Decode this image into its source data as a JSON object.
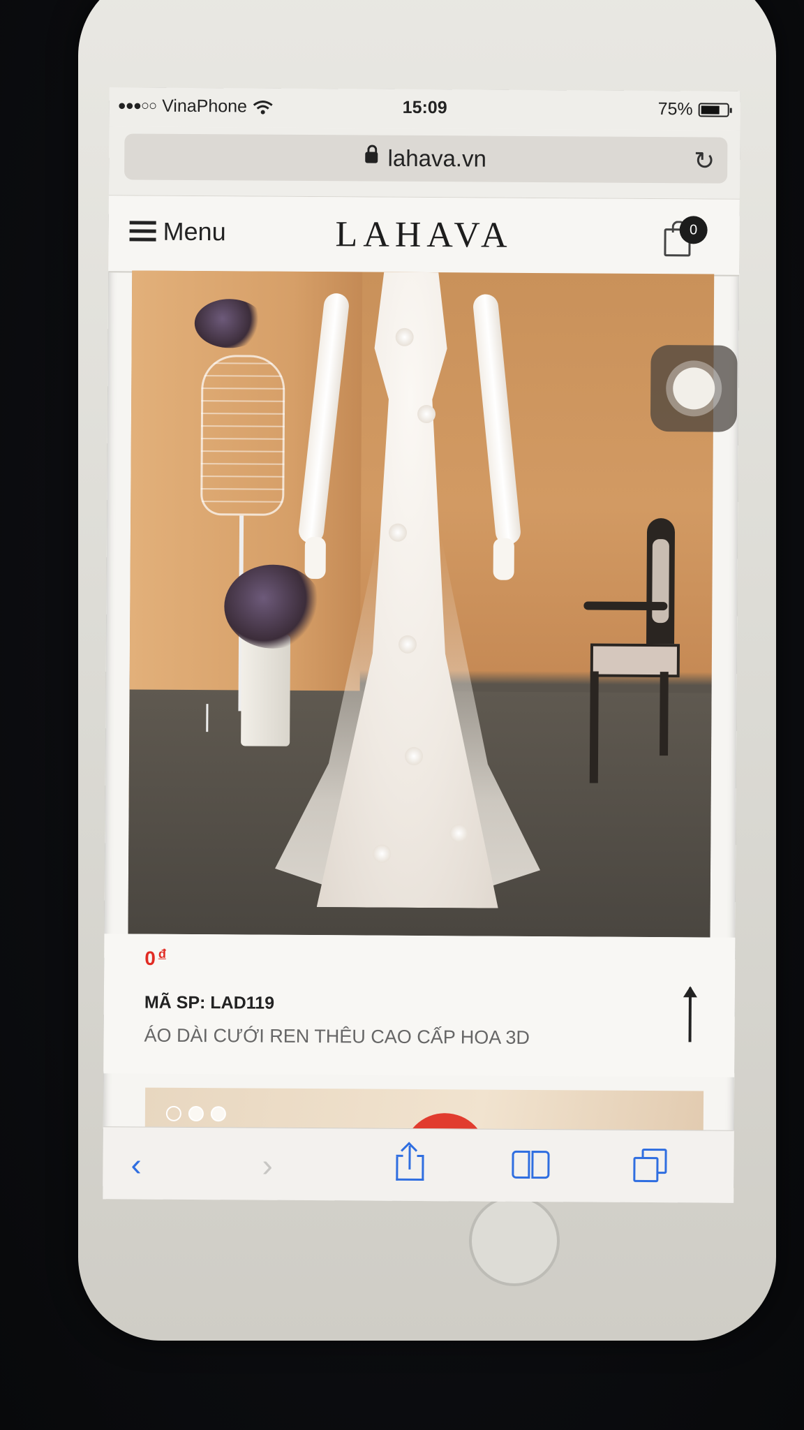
{
  "status_bar": {
    "carrier": "VinaPhone",
    "signal": "●●●○○",
    "time": "15:09",
    "battery_text": "75%",
    "battery_level": 0.75
  },
  "browser": {
    "url": "lahava.vn"
  },
  "site_header": {
    "menu_label": "Menu",
    "logo": "LAHAVA",
    "cart_count": "0"
  },
  "product": {
    "price": "0",
    "currency": "đ",
    "sku": "MÃ SP: LAD119",
    "name": "ÁO DÀI CƯỚI REN THÊU CAO CẤP HOA 3D"
  },
  "carousel": {
    "dots": 3,
    "active_dot": 1
  },
  "safari_toolbar": {
    "back": "‹",
    "forward": "›"
  },
  "colors": {
    "price": "#e12b23",
    "toolbar_accent": "#2f6ee0"
  }
}
